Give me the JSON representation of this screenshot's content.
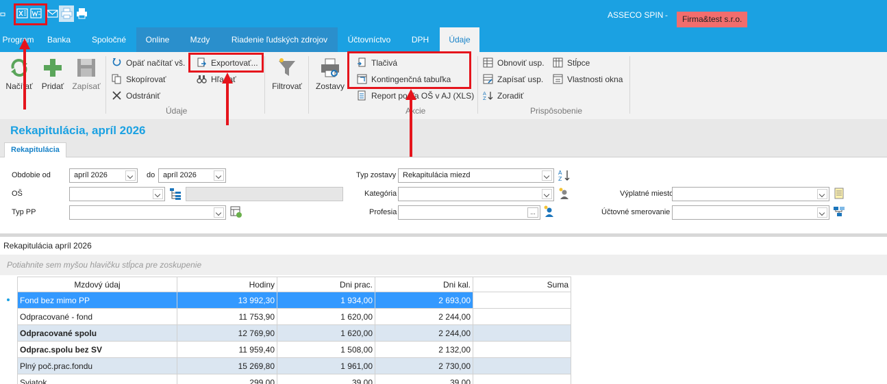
{
  "titlebar": {
    "brand": "ASSECO SPIN",
    "separator": "-",
    "company": "Firma&test s.r.o.",
    "quick_access_icons": [
      "excel-icon",
      "word-icon",
      "mail-icon",
      "print-preview-icon",
      "print-icon"
    ]
  },
  "tabs": [
    {
      "label": "Program"
    },
    {
      "label": "Banka"
    },
    {
      "label": "Spoločné"
    },
    {
      "label": "Online"
    },
    {
      "label": "Mzdy"
    },
    {
      "label": "Riadenie ľudských zdrojov"
    },
    {
      "label": "Účtovníctvo"
    },
    {
      "label": "DPH"
    },
    {
      "label": "Údaje",
      "active": true
    }
  ],
  "ribbon": {
    "big_buttons": {
      "load": "Načítať",
      "add": "Pridať",
      "save": "Zapísať",
      "filter": "Filtrovať",
      "reports": "Zostavy"
    },
    "data_group": {
      "reload": "Opäť načítať vš.",
      "copy": "Skopírovať",
      "delete": "Odstrániť",
      "export": "Exportovať...",
      "search": "Hľadať",
      "label": "Údaje"
    },
    "actions_group": {
      "forms": "Tlačivá",
      "pivot": "Kontingenčná tabuľka",
      "report": "Report podľa OŠ v AJ (XLS)",
      "label": "Akcie"
    },
    "customize_group": {
      "restore": "Obnoviť usp.",
      "write": "Zapísať usp.",
      "sort": "Zoradiť",
      "columns": "Stĺpce",
      "window_props": "Vlastnosti okna",
      "label": "Prispôsobenie"
    }
  },
  "page": {
    "title": "Rekapitulácia, apríl 2026",
    "subtab": "Rekapitulácia"
  },
  "filters": {
    "period_from_label": "Obdobie od",
    "period_from": "apríl 2026",
    "period_to_label": "do",
    "period_to": "apríl 2026",
    "os_label": "OŠ",
    "os_value": "",
    "pp_type_label": "Typ PP",
    "pp_type_value": "",
    "report_type_label": "Typ zostavy",
    "report_type": "Rekapitulácia miezd",
    "category_label": "Kategória",
    "category": "",
    "profession_label": "Profesia",
    "profession": "",
    "ellipsis": "...",
    "payout_place_label": "Výplatné miesto",
    "payout_place": "",
    "accounting_label": "Účtovné smerovanie",
    "accounting": ""
  },
  "grid": {
    "title": "Rekapitulácia apríl 2026",
    "group_hint": "Potiahnite sem myšou hlavičku stĺpca pre zoskupenie",
    "columns": [
      "Mzdový údaj",
      "Hodiny",
      "Dni prac.",
      "Dni kal.",
      "Suma"
    ],
    "rows": [
      {
        "name": "Fond bez mimo PP",
        "hours": "13 992,30",
        "work_days": "1 934,00",
        "cal_days": "2 693,00",
        "sum": ""
      },
      {
        "name": "Odpracované - fond",
        "hours": "11 753,90",
        "work_days": "1 620,00",
        "cal_days": "2 244,00",
        "sum": ""
      },
      {
        "name": "Odpracované spolu",
        "hours": "12 769,90",
        "work_days": "1 620,00",
        "cal_days": "2 244,00",
        "sum": ""
      },
      {
        "name": "Odprac.spolu bez SV",
        "hours": "11 959,40",
        "work_days": "1 508,00",
        "cal_days": "2 132,00",
        "sum": ""
      },
      {
        "name": "Plný poč.prac.fondu",
        "hours": "15 269,80",
        "work_days": "1 961,00",
        "cal_days": "2 730,00",
        "sum": ""
      },
      {
        "name": "Sviatok",
        "hours": "299,00",
        "work_days": "39,00",
        "cal_days": "39,00",
        "sum": ""
      }
    ]
  },
  "colors": {
    "accent": "#1ba1e2",
    "badge": "#f26d6d",
    "selected_row": "#3399ff",
    "annotation": "#e5141c"
  }
}
